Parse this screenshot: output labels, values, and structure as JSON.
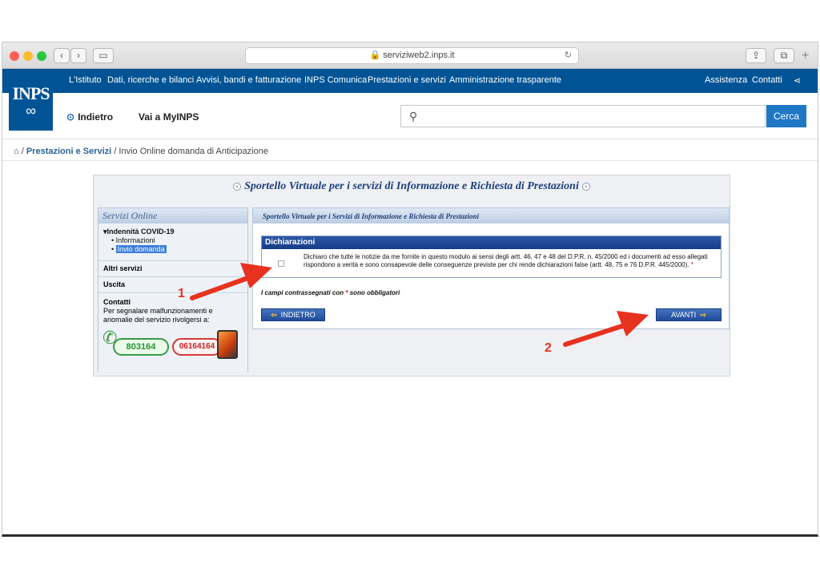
{
  "browser": {
    "url": "serviziweb2.inps.it",
    "back_glyph": "‹",
    "forward_glyph": "›"
  },
  "topnav": {
    "items": [
      "L'Istituto",
      "Dati, ricerche e bilanci",
      "Avvisi, bandi e fatturazione",
      "INPS Comunica",
      "Prestazioni e servizi",
      "Amministrazione trasparente"
    ],
    "right": [
      "Assistenza",
      "Contatti"
    ]
  },
  "logo": {
    "text": "INPS"
  },
  "subheader": {
    "back_label": "Indietro",
    "myinps_label": "Vai a MyINPS",
    "search_placeholder": "",
    "search_button": "Cerca"
  },
  "breadcrumb": {
    "home_icon": "home-icon",
    "sep": "/",
    "level1": "Prestazioni e Servizi",
    "level2": "Invio Online domanda di Anticipazione"
  },
  "sportello": {
    "title": "Sportello Virtuale per i servizi di Informazione e Richiesta di Prestazioni"
  },
  "sidebar": {
    "header": "Servizi Online",
    "group_title": "Indennità COVID-19",
    "group_items": [
      "Informazioni",
      "Invio domanda"
    ],
    "other": "Altri servizi",
    "exit": "Uscita",
    "contacts_title": "Contatti",
    "contacts_text": "Per segnalare malfunzionamenti e anomalie del servizio rivolgersi a:",
    "phone_green": "803164",
    "phone_red": "06164164"
  },
  "main": {
    "header": "Sportello Virtuale per i Servizi di Informazione e Richiesta di Prestazioni",
    "decl_title": "Dichiarazioni",
    "decl_text": "Dichiaro che tutte le notizie da me fornite in questo modulo ai sensi degli artt. 46, 47 e 48 del D.P.R. n. 45/2000 ed i documenti ad esso allegati rispondono a verità e sono consapevole delle conseguenze previste per chi rende dichiarazioni false (artt. 48, 75 e 76 D.P.R. 445/2000).",
    "required_mark": "*",
    "note_pre": "I campi contrassegnati con",
    "note_post": "sono obbligatori",
    "back_btn": "INDIETRO",
    "next_btn": "AVANTI"
  },
  "annotations": {
    "one": "1",
    "two": "2"
  },
  "colors": {
    "brand": "#005495",
    "accent": "#1e77c5",
    "arrow": "#e6321e"
  }
}
